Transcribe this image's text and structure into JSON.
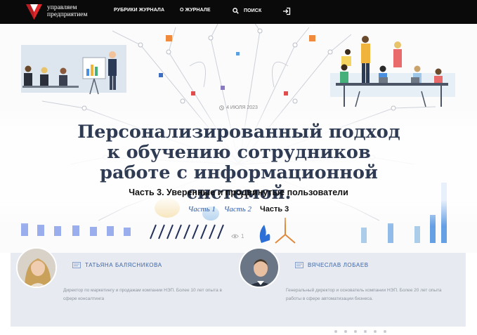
{
  "header": {
    "logo_line1": "управляем",
    "logo_line2": "предприятием",
    "nav": {
      "rubrics": "РУБРИКИ ЖУРНАЛА",
      "about": "О ЖУРНАЛЕ",
      "search": "ПОИСК"
    },
    "icons": [
      "search-icon",
      "login-icon"
    ]
  },
  "article": {
    "date": "4 ИЮЛЯ 2023",
    "title": "Персонализированный подход к обучению сотрудников работе с информационной системой.",
    "subtitle": "Часть 3. Уверенные и продвинутые пользователи",
    "parts": {
      "part1": "Часть 1",
      "part2": "Часть 2",
      "part3": "Часть 3"
    },
    "views": "1"
  },
  "authors": [
    {
      "name": "ТАТЬЯНА БАЛЯСНИКОВА",
      "bio": "Директор по маркетингу и продажам компании НЭП. Более 10 лет опыта в сфере консалтинга"
    },
    {
      "name": "ВЯЧЕСЛАВ ЛОБАЕВ",
      "bio": "Генеральный директор и основатель компании НЭП. Более 20 лет опыта работы в сфере автоматизации бизнеса."
    }
  ],
  "colors": {
    "topbar": "#0a0a0a",
    "logo_red": "#e3262a",
    "title": "#2e3b52",
    "link": "#2c5aa8",
    "author_band": "#e7ebf1"
  }
}
